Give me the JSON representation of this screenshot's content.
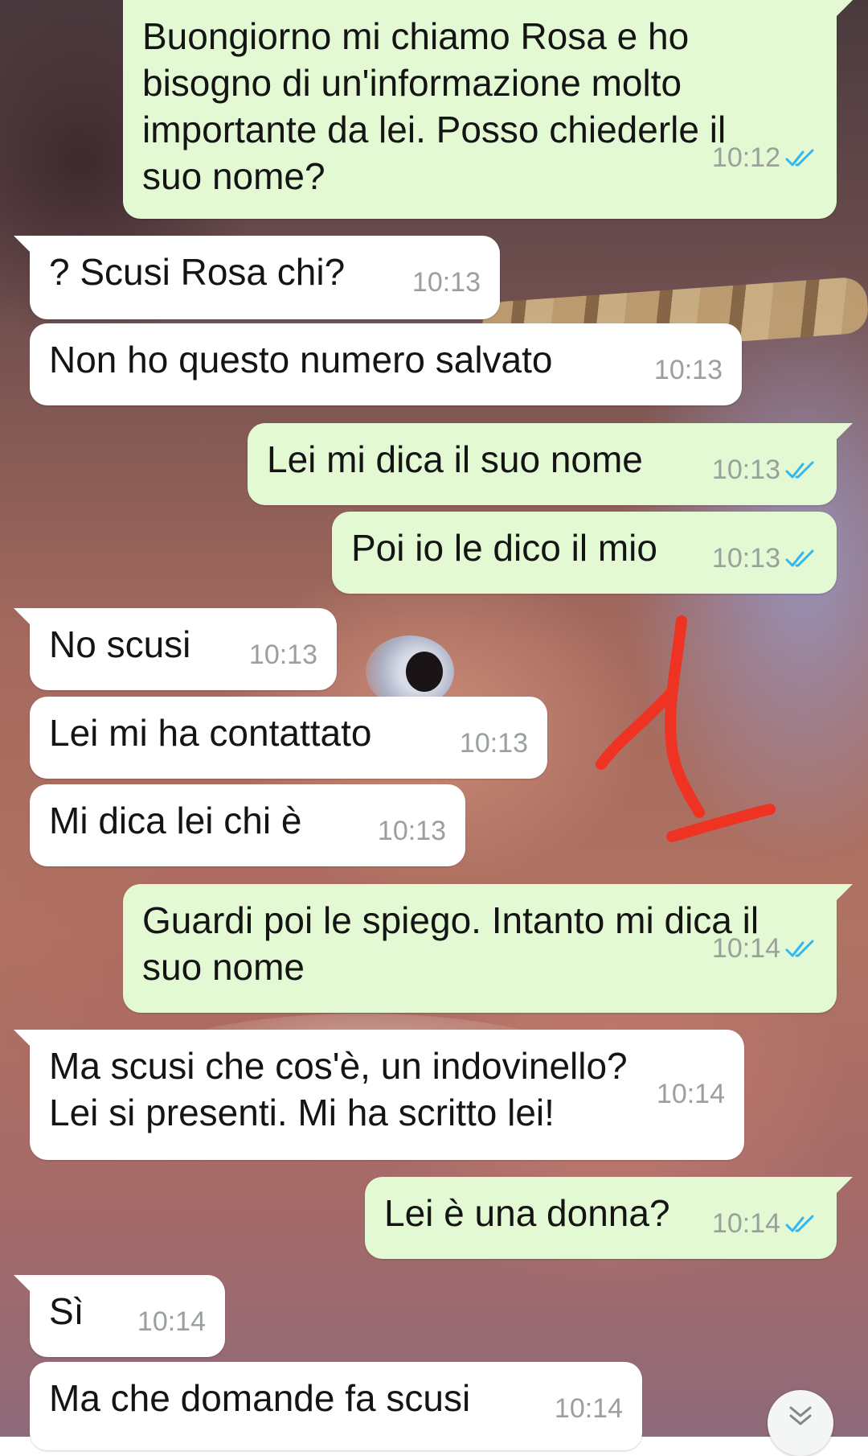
{
  "messages": [
    {
      "dir": "out",
      "text": "Buongiorno mi chiamo Rosa e ho\nbisogno di un'informazione molto\nimportante da lei. Posso chiederle il\nsuo nome?",
      "time": "10:12",
      "read": true
    },
    {
      "dir": "in",
      "text": "? Scusi Rosa chi?",
      "time": "10:13"
    },
    {
      "dir": "in",
      "text": "Non ho questo numero salvato",
      "time": "10:13"
    },
    {
      "dir": "out",
      "text": "Lei mi dica il suo nome",
      "time": "10:13",
      "read": true
    },
    {
      "dir": "out",
      "text": "Poi io le dico il mio",
      "time": "10:13",
      "read": true
    },
    {
      "dir": "in",
      "text": "No scusi",
      "time": "10:13"
    },
    {
      "dir": "in",
      "text": "Lei mi ha contattato",
      "time": "10:13"
    },
    {
      "dir": "in",
      "text": "Mi dica lei chi è",
      "time": "10:13"
    },
    {
      "dir": "out",
      "text": "Guardi poi le spiego. Intanto mi dica il\nsuo nome",
      "time": "10:14",
      "read": true
    },
    {
      "dir": "in",
      "text": "Ma scusi che cos'è, un indovinello?\nLei si presenti. Mi ha scritto lei!",
      "time": "10:14"
    },
    {
      "dir": "out",
      "text": "Lei è una donna?",
      "time": "10:14",
      "read": true
    },
    {
      "dir": "in",
      "text": "Sì",
      "time": "10:14"
    },
    {
      "dir": "in",
      "text": "Ma che domande fa scusi",
      "time": "10:14"
    }
  ],
  "colors": {
    "outgoing_bubble": "#e3f9d3",
    "incoming_bubble": "#ffffff",
    "read_ticks": "#34b7f1",
    "annotation": "#ee3322"
  },
  "icons": {
    "read_receipt": "double-check-icon",
    "scroll_down": "double-chevron-down-icon"
  }
}
